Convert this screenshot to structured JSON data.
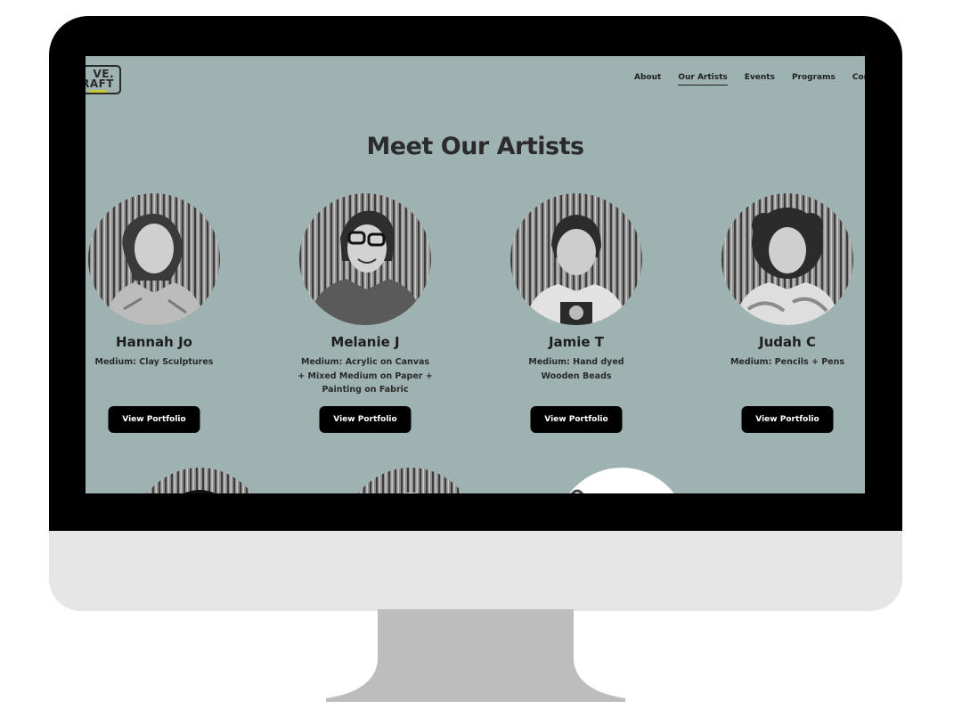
{
  "site": {
    "logo": {
      "line1": "VE.",
      "line2": "RAFT"
    },
    "nav": [
      {
        "label": "About",
        "active": false
      },
      {
        "label": "Our Artists",
        "active": true
      },
      {
        "label": "Events",
        "active": false
      },
      {
        "label": "Programs",
        "active": false
      },
      {
        "label": "Conta",
        "active": false
      }
    ],
    "page_title": "Meet Our Artists",
    "artists": [
      {
        "name": "Hannah Jo",
        "medium": "Medium: Clay Sculptures",
        "button": "View Portfolio"
      },
      {
        "name": "Melanie J",
        "medium": "Medium: Acrylic on Canvas\n+ Mixed Medium on Paper +\nPainting on Fabric",
        "button": "View Portfolio"
      },
      {
        "name": "Jamie T",
        "medium": "Medium: Hand dyed\nWooden Beads",
        "button": "View Portfolio"
      },
      {
        "name": "Judah C",
        "medium": "Medium: Pencils + Pens",
        "button": "View Portfolio"
      }
    ]
  },
  "colors": {
    "background": "#9eb2b1",
    "text": "#1e1e1e",
    "button": "#000000",
    "button_text": "#ffffff",
    "bezel": "#000000",
    "chin": "#e6e6e6",
    "stand": "#bdbdbd"
  }
}
